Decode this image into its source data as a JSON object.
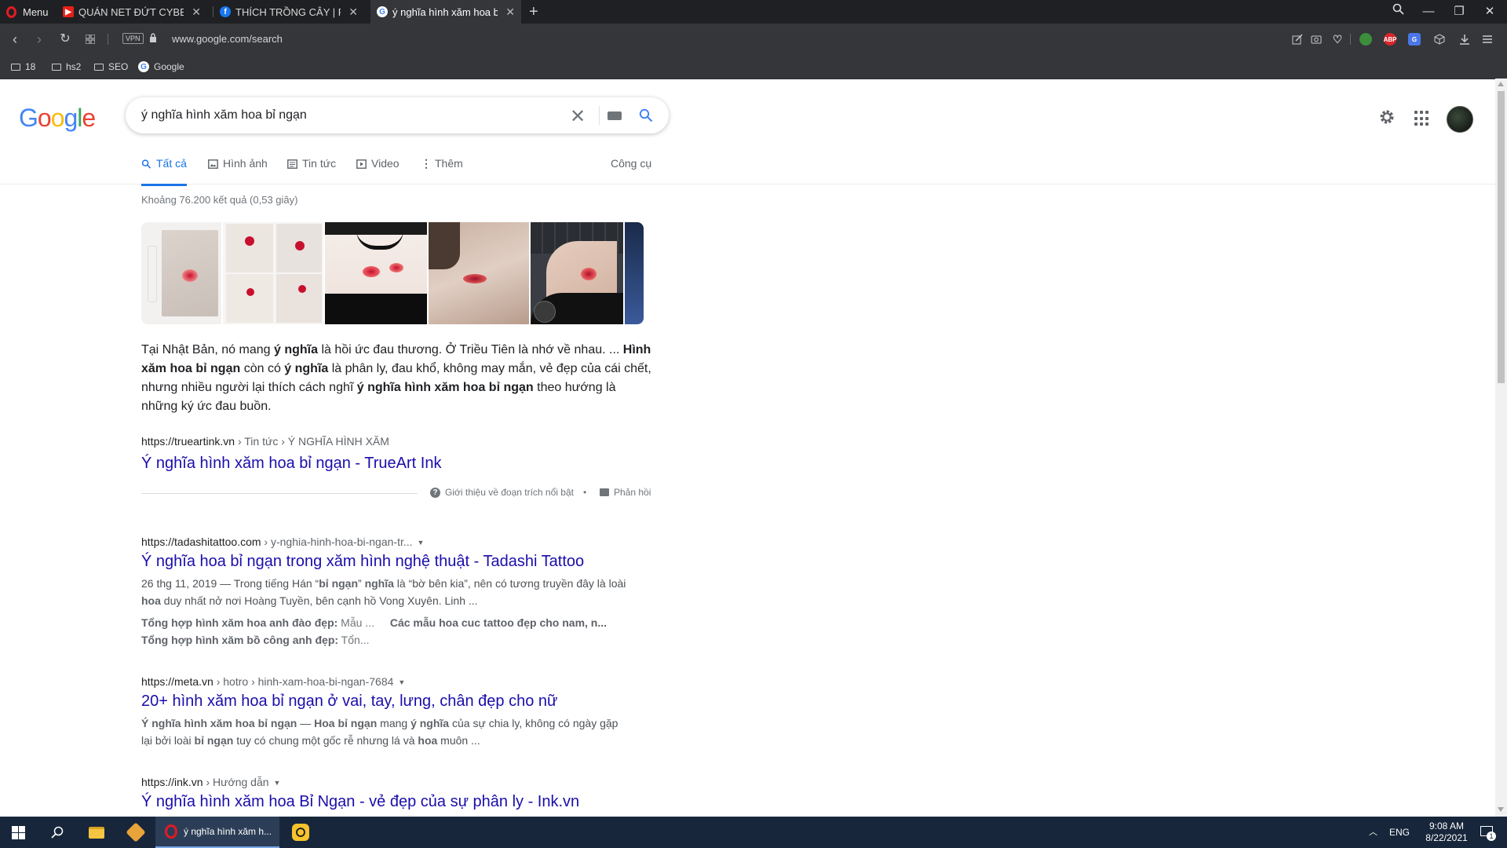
{
  "browser": {
    "menu_label": "Menu",
    "tabs": [
      {
        "title": "QUÁN NET ĐỨT CYBER BIẾ",
        "favicon": "youtube-icon",
        "active": false
      },
      {
        "title": "THÍCH TRỒNG CÂY | Faceb",
        "favicon": "facebook-icon",
        "active": false
      },
      {
        "title": "ý nghĩa hình xăm hoa bỉ ng",
        "favicon": "google-icon",
        "active": true
      }
    ],
    "vpn_label": "VPN",
    "url": "www.google.com/search",
    "bookmarks": [
      {
        "label": "18",
        "icon": "folder-icon"
      },
      {
        "label": "hs2",
        "icon": "folder-icon"
      },
      {
        "label": "SEO",
        "icon": "folder-icon"
      },
      {
        "label": "Google",
        "icon": "google-icon"
      }
    ],
    "extensions": {
      "abp": "ABP"
    }
  },
  "google": {
    "logo": "Google",
    "logo_colors": [
      "#4285F4",
      "#EA4335",
      "#FBBC05",
      "#4285F4",
      "#34A853",
      "#EA4335"
    ],
    "query": "ý nghĩa hình xăm hoa bỉ ngạn",
    "nav_tabs": [
      {
        "label": "Tất cả",
        "icon": "search-icon",
        "active": true
      },
      {
        "label": "Hình ảnh",
        "icon": "image-icon",
        "active": false
      },
      {
        "label": "Tin tức",
        "icon": "news-icon",
        "active": false
      },
      {
        "label": "Video",
        "icon": "video-icon",
        "active": false
      },
      {
        "label": "Thêm",
        "icon": "more-vert-icon",
        "active": false
      }
    ],
    "tools_label": "Công cụ",
    "result_stats": "Khoảng 76.200 kết quả (0,53 giây)",
    "featured_snippet": {
      "text_parts": [
        {
          "t": "Tại Nhật Bản, nó mang ",
          "b": false
        },
        {
          "t": "ý nghĩa",
          "b": true
        },
        {
          "t": " là hồi ức đau thương. Ở Triều Tiên là nhớ về nhau. ... ",
          "b": false
        },
        {
          "t": "Hình xăm hoa bỉ ngạn",
          "b": true
        },
        {
          "t": " còn có ",
          "b": false
        },
        {
          "t": "ý nghĩa",
          "b": true
        },
        {
          "t": " là phân ly, đau khổ, không may mắn, vẻ đẹp của cái chết, nhưng nhiều người lại thích cách nghĩ ",
          "b": false
        },
        {
          "t": "ý nghĩa hình xăm hoa bỉ ngạn",
          "b": true
        },
        {
          "t": " theo hướng là những ký ức đau buồn.",
          "b": false
        }
      ],
      "source_url": "https://trueartink.vn",
      "source_breadcrumb": " › Tin tức › Ý NGHĨA HÌNH XĂM",
      "title": "Ý nghĩa hình xăm hoa bỉ ngạn - TrueArt Ink",
      "about_label": "Giới thiệu về đoạn trích nổi bật",
      "bullet": "•",
      "feedback_label": "Phản hồi"
    },
    "results": [
      {
        "url": "https://tadashitattoo.com",
        "breadcrumb": " › y-nghia-hinh-hoa-bi-ngan-tr...",
        "title": "Ý nghĩa hoa bỉ ngạn trong xăm hình nghệ thuật - Tadashi Tattoo",
        "desc_parts": [
          {
            "t": "26 thg 11, 2019 — Trong tiếng Hán “",
            "b": false
          },
          {
            "t": "bỉ ngạn",
            "b": true
          },
          {
            "t": "” ",
            "b": false
          },
          {
            "t": "nghĩa",
            "b": true
          },
          {
            "t": " là “bờ bên kia”, nên có tương truyền đây là loài ",
            "b": false
          },
          {
            "t": "hoa",
            "b": true
          },
          {
            "t": " duy nhất nở nơi Hoàng Tuyền, bên cạnh hồ Vong Xuyên. Linh ...",
            "b": false
          }
        ],
        "sitelinks": [
          {
            "bold": "Tổng hợp hình xăm hoa anh đào đẹp:",
            "rest": " Mẫu ..."
          },
          {
            "bold": "Các mẫu hoa cuc tattoo đẹp cho nam, n...",
            "rest": ""
          },
          {
            "bold": "Tổng hợp hình xăm bồ công anh đẹp:",
            "rest": " Tổn..."
          }
        ]
      },
      {
        "url": "https://meta.vn",
        "breadcrumb": " › hotro › hinh-xam-hoa-bi-ngan-7684",
        "title": "20+ hình xăm hoa bỉ ngạn ở vai, tay, lưng, chân đẹp cho nữ",
        "desc_parts": [
          {
            "t": "Ý nghĩa hình xăm hoa bỉ ngạn",
            "b": true
          },
          {
            "t": " — ",
            "b": false
          },
          {
            "t": "Hoa bỉ ngạn",
            "b": true
          },
          {
            "t": " mang ",
            "b": false
          },
          {
            "t": "ý nghĩa",
            "b": true
          },
          {
            "t": " của sự chia ly, không có ngày gặp lại bởi loài ",
            "b": false
          },
          {
            "t": "bỉ ngạn",
            "b": true
          },
          {
            "t": " tuy có chung một gốc rễ nhưng lá và ",
            "b": false
          },
          {
            "t": "hoa",
            "b": true
          },
          {
            "t": " muôn ...",
            "b": false
          }
        ]
      },
      {
        "url": "https://ink.vn",
        "breadcrumb": " › Hướng dẫn",
        "title": "Ý nghĩa hình xăm hoa Bỉ Ngạn - vẻ đẹp của sự phân ly - Ink.vn"
      }
    ]
  },
  "taskbar": {
    "active_window": "ý nghĩa hình xăm h...",
    "language": "ENG",
    "time": "9:08 AM",
    "date": "8/22/2021",
    "notification_count": "1"
  }
}
